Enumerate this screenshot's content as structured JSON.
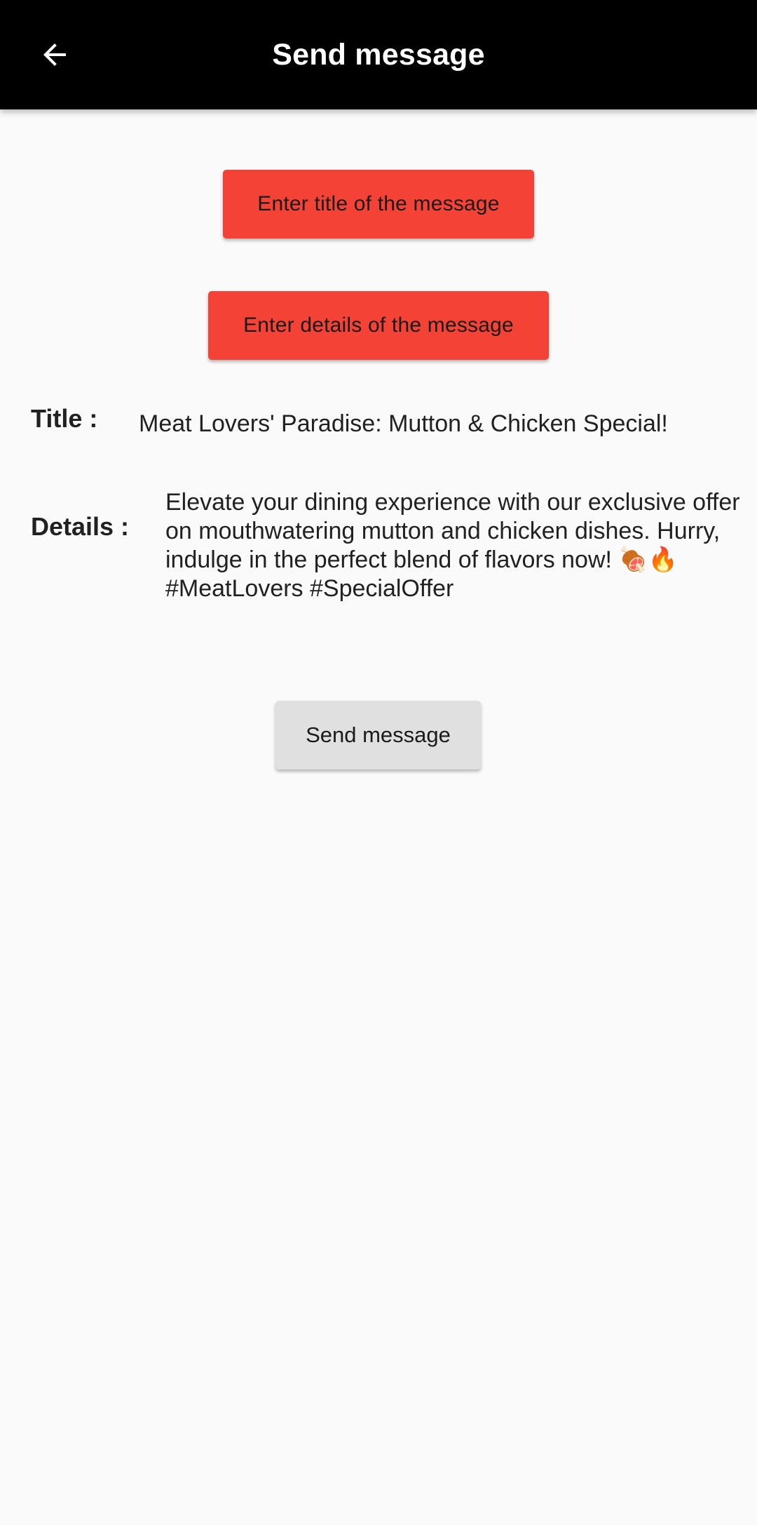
{
  "appbar": {
    "title": "Send message",
    "back_icon": "arrow-left-icon",
    "background": "#000000",
    "text_color": "#ffffff"
  },
  "form": {
    "enter_title_button": "Enter title of the message",
    "enter_details_button": "Enter details of the message",
    "button_color": "#f44336"
  },
  "preview": {
    "title_label": "Title :",
    "title_value": "Meat Lovers' Paradise: Mutton & Chicken Special!",
    "details_label": "Details :",
    "details_value": "Elevate your dining experience with our exclusive offer on mouthwatering mutton and chicken dishes. Hurry, indulge in the perfect blend of flavors now! 🍖🔥 #MeatLovers #SpecialOffer"
  },
  "actions": {
    "send_button": "Send message",
    "send_button_color": "#e0e0e0"
  }
}
